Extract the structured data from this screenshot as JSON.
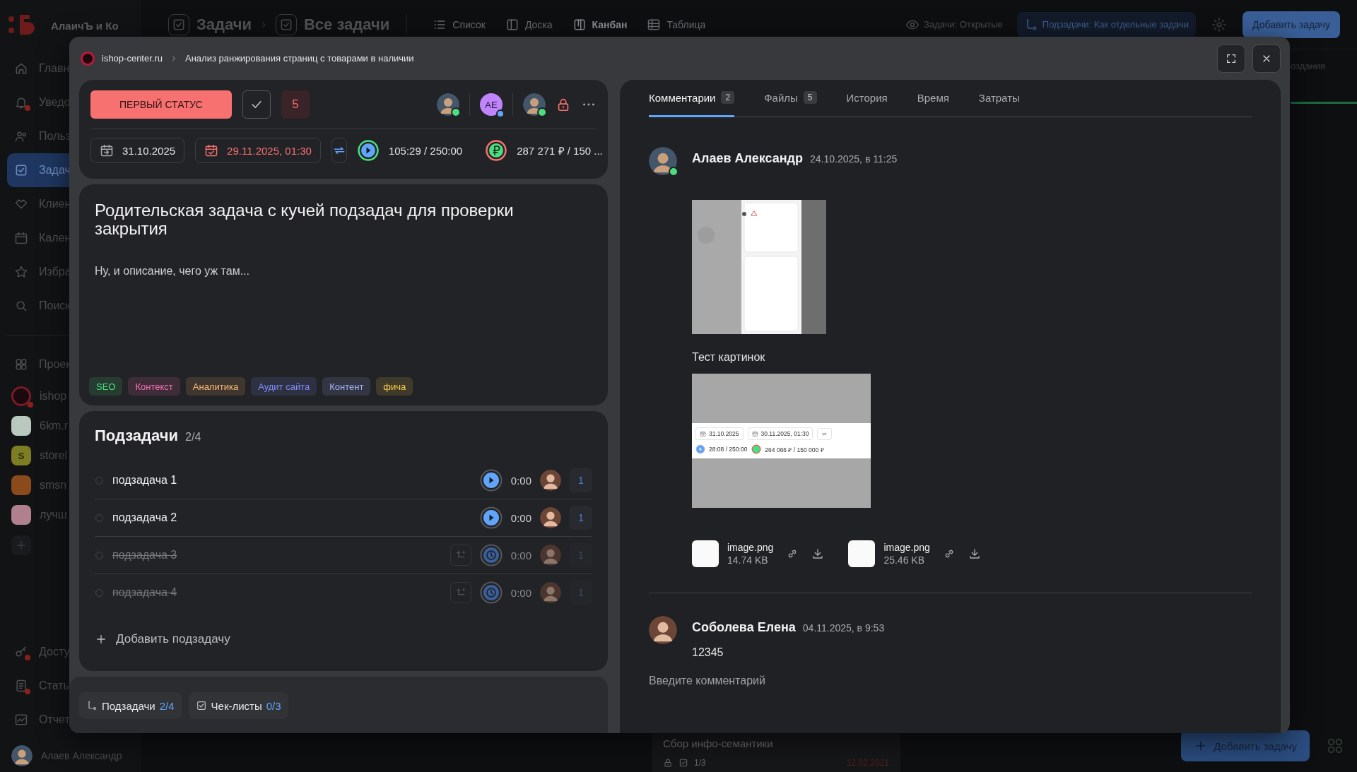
{
  "app": {
    "logo": "АлаичЪ и Ко",
    "breadcrumb": [
      "Задачи",
      "Все задачи"
    ],
    "views": [
      {
        "label": "Список",
        "selected": false
      },
      {
        "label": "Доска",
        "selected": false
      },
      {
        "label": "Канбан",
        "selected": true
      },
      {
        "label": "Таблица",
        "selected": false
      }
    ],
    "filters": [
      {
        "label": "Задачи: Открытые",
        "kind": "plain"
      },
      {
        "label": "Подзадачи: Как отдельные задачи",
        "kind": "accent"
      }
    ],
    "add_button": "Добавить задачу",
    "sidebar": {
      "nav": [
        {
          "label": "Главн",
          "selected": false,
          "badge": false
        },
        {
          "label": "Уведо",
          "selected": false,
          "badge": true
        },
        {
          "label": "Польз",
          "selected": false,
          "badge": false
        },
        {
          "label": "Задач",
          "selected": true,
          "badge": false
        },
        {
          "label": "Клиен",
          "selected": false,
          "badge": false
        },
        {
          "label": "Кален",
          "selected": false,
          "badge": false
        },
        {
          "label": "Избра",
          "selected": false,
          "badge": false
        },
        {
          "label": "Поиск",
          "selected": false,
          "badge": false
        }
      ],
      "projects_label": "Проек",
      "projects": [
        {
          "label": "ishop",
          "kind": "ring",
          "color": "#7a1a28",
          "badge": true
        },
        {
          "label": "6km.r",
          "kind": "logo",
          "color": "#b9c9bd",
          "badge": false
        },
        {
          "label": "storel",
          "kind": "letter",
          "letter": "S",
          "color": "#7d7d22",
          "badge": false
        },
        {
          "label": "smsn",
          "kind": "logo",
          "color": "#8a4a1a",
          "badge": false
        },
        {
          "label": "лучш",
          "kind": "logo",
          "color": "#b0808e",
          "badge": false
        }
      ],
      "bottom": [
        {
          "label": "Досту",
          "badge": true
        },
        {
          "label": "Стать",
          "badge": true
        },
        {
          "label": "Отчет",
          "badge": false
        }
      ],
      "user": "Алаев Александр"
    },
    "column_header": "оздания",
    "card": {
      "title": "Сбор инфо-семантики",
      "checklist": "1/3",
      "date": "12.02.2021"
    },
    "floating_button": "Добавить задачу"
  },
  "modal": {
    "project": "ishop-center.ru",
    "task": "Анализ ранжирования страниц с товарами в наличии",
    "status": "ПЕРВЫЙ СТАТУС",
    "priority": "5",
    "people": [
      {
        "kind": "photo",
        "online": true
      },
      {
        "kind": "initials",
        "initials": "АЕ",
        "online": false
      },
      {
        "kind": "photo",
        "online": true
      }
    ],
    "start_date": "31.10.2025",
    "deadline": {
      "value": "29.11.2025, 01:30",
      "overdue": true
    },
    "time": "105:29 / 250:00",
    "cost": "287 271 ₽ / 150 ...",
    "title": "Родительская задача с кучей подзадач для проверки закрытия",
    "description": "Ну, и описание, чего уж там...",
    "tags": [
      {
        "label": "SEO",
        "color": "#4ade80"
      },
      {
        "label": "Контекст",
        "color": "#f472b6"
      },
      {
        "label": "Аналитика",
        "color": "#fdba74"
      },
      {
        "label": "Аудит сайта",
        "color": "#818cf8"
      },
      {
        "label": "Контент",
        "color": "#a5b4fc"
      },
      {
        "label": "фича",
        "color": "#fcd34d"
      }
    ],
    "subtasks": {
      "title": "Подзадачи",
      "count": "2/4",
      "items": [
        {
          "name": "подзадача 1",
          "done": false,
          "time": "0:00",
          "count": "1"
        },
        {
          "name": "подзадача 2",
          "done": false,
          "time": "0:00",
          "count": "1"
        },
        {
          "name": "подзадача 3",
          "done": true,
          "time": "0:00",
          "count": "1"
        },
        {
          "name": "подзадача 4",
          "done": true,
          "time": "0:00",
          "count": "1"
        }
      ],
      "add": "Добавить подзадачу"
    },
    "footer_tabs": [
      {
        "label": "Подзадачи",
        "count": "2/4"
      },
      {
        "label": "Чек-листы",
        "count": "0/3"
      }
    ],
    "tabs": [
      {
        "label": "Комментарии",
        "count": "2",
        "selected": true
      },
      {
        "label": "Файлы",
        "count": "5",
        "selected": false
      },
      {
        "label": "История",
        "selected": false
      },
      {
        "label": "Время",
        "selected": false
      },
      {
        "label": "Затраты",
        "selected": false
      }
    ],
    "comments": [
      {
        "author": "Алаев Александр",
        "date": "24.10.2025, в 11:25",
        "online": true,
        "blocks": [
          {
            "kind": "image"
          },
          {
            "kind": "text",
            "text": "Тест картинок"
          },
          {
            "kind": "screenshot",
            "start": "31.10.2025",
            "deadline": "30.11.2025, 01:30",
            "time": "28:08 / 250:00",
            "cost": "264 066 ₽ / 150 000 ₽"
          },
          {
            "kind": "files",
            "files": [
              {
                "name": "image.png",
                "size": "14.74 KB"
              },
              {
                "name": "image.png",
                "size": "25.46 KB"
              }
            ]
          }
        ]
      },
      {
        "author": "Соболева Елена",
        "date": "04.11.2025, в 9:53",
        "online": false,
        "blocks": [
          {
            "kind": "text",
            "text": "12345"
          }
        ]
      }
    ],
    "comment_input": {
      "placeholder": "Введите комментарий"
    }
  }
}
